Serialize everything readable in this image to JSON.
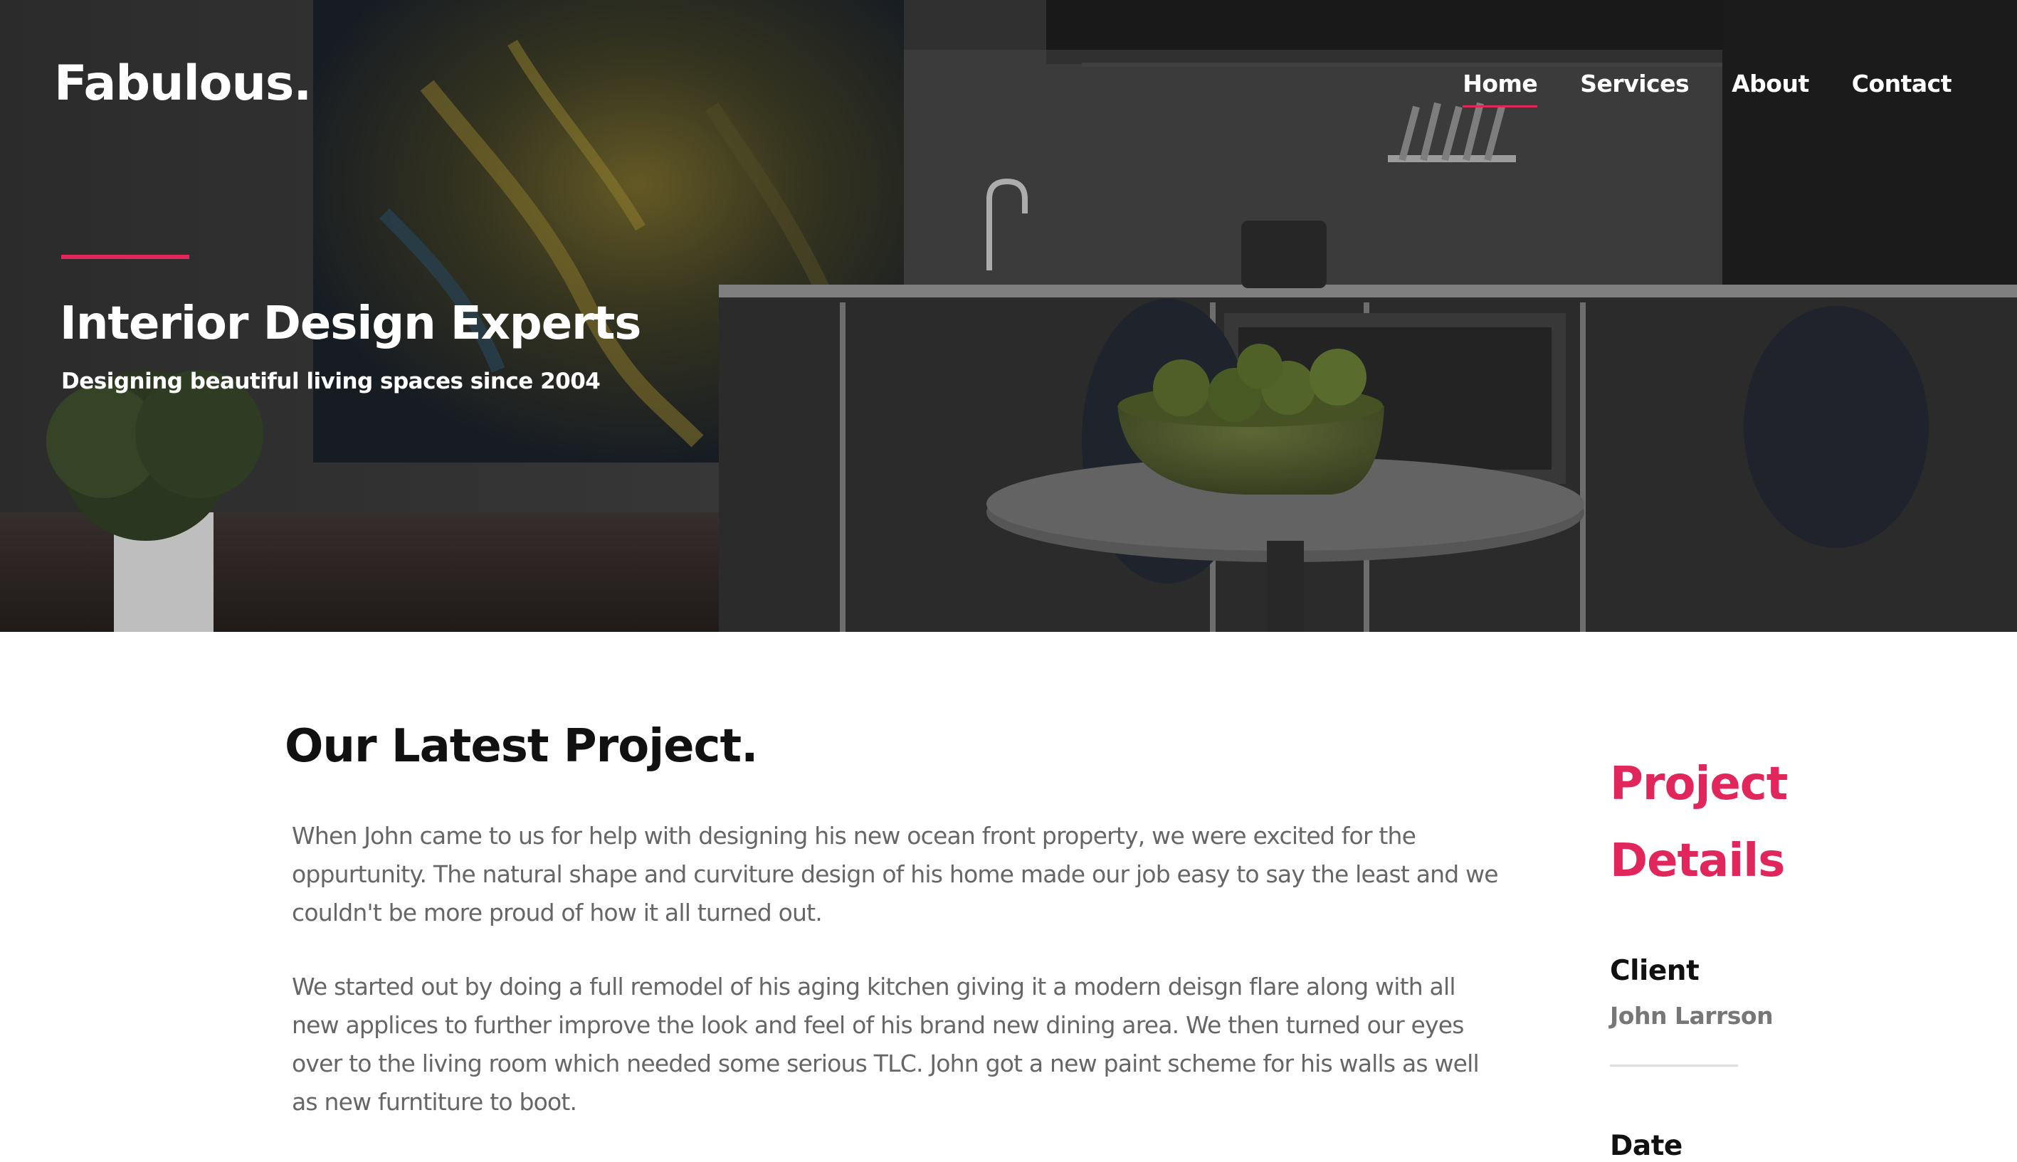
{
  "brand": {
    "logo": "Fabulous."
  },
  "nav": {
    "items": [
      {
        "label": "Home",
        "active": true
      },
      {
        "label": "Services",
        "active": false
      },
      {
        "label": "About",
        "active": false
      },
      {
        "label": "Contact",
        "active": false
      }
    ]
  },
  "hero": {
    "title": "Interior Design Experts",
    "subtitle": "Designing beautiful living spaces since 2004"
  },
  "project": {
    "title": "Our Latest Project.",
    "paragraphs": [
      "When John came to us for help with designing his new ocean front property, we were excited for the oppurtunity. The natural shape and curviture design of his home made our job easy to say the least and we couldn't be more proud of how it all turned out.",
      "We started out by doing a full remodel of his aging kitchen giving it a modern deisgn flare along with all new applices to further improve the look and feel of his brand new dining area. We then turned our eyes over to the living room which needed some serious TLC. John got a new paint scheme for his walls as well as new furntiture to boot."
    ]
  },
  "details": {
    "title": "Project Details",
    "client_label": "Client",
    "client_value": "John Larrson",
    "date_label": "Date"
  },
  "colors": {
    "accent": "#e0265b",
    "heading": "#111111",
    "body_text": "#666666"
  }
}
